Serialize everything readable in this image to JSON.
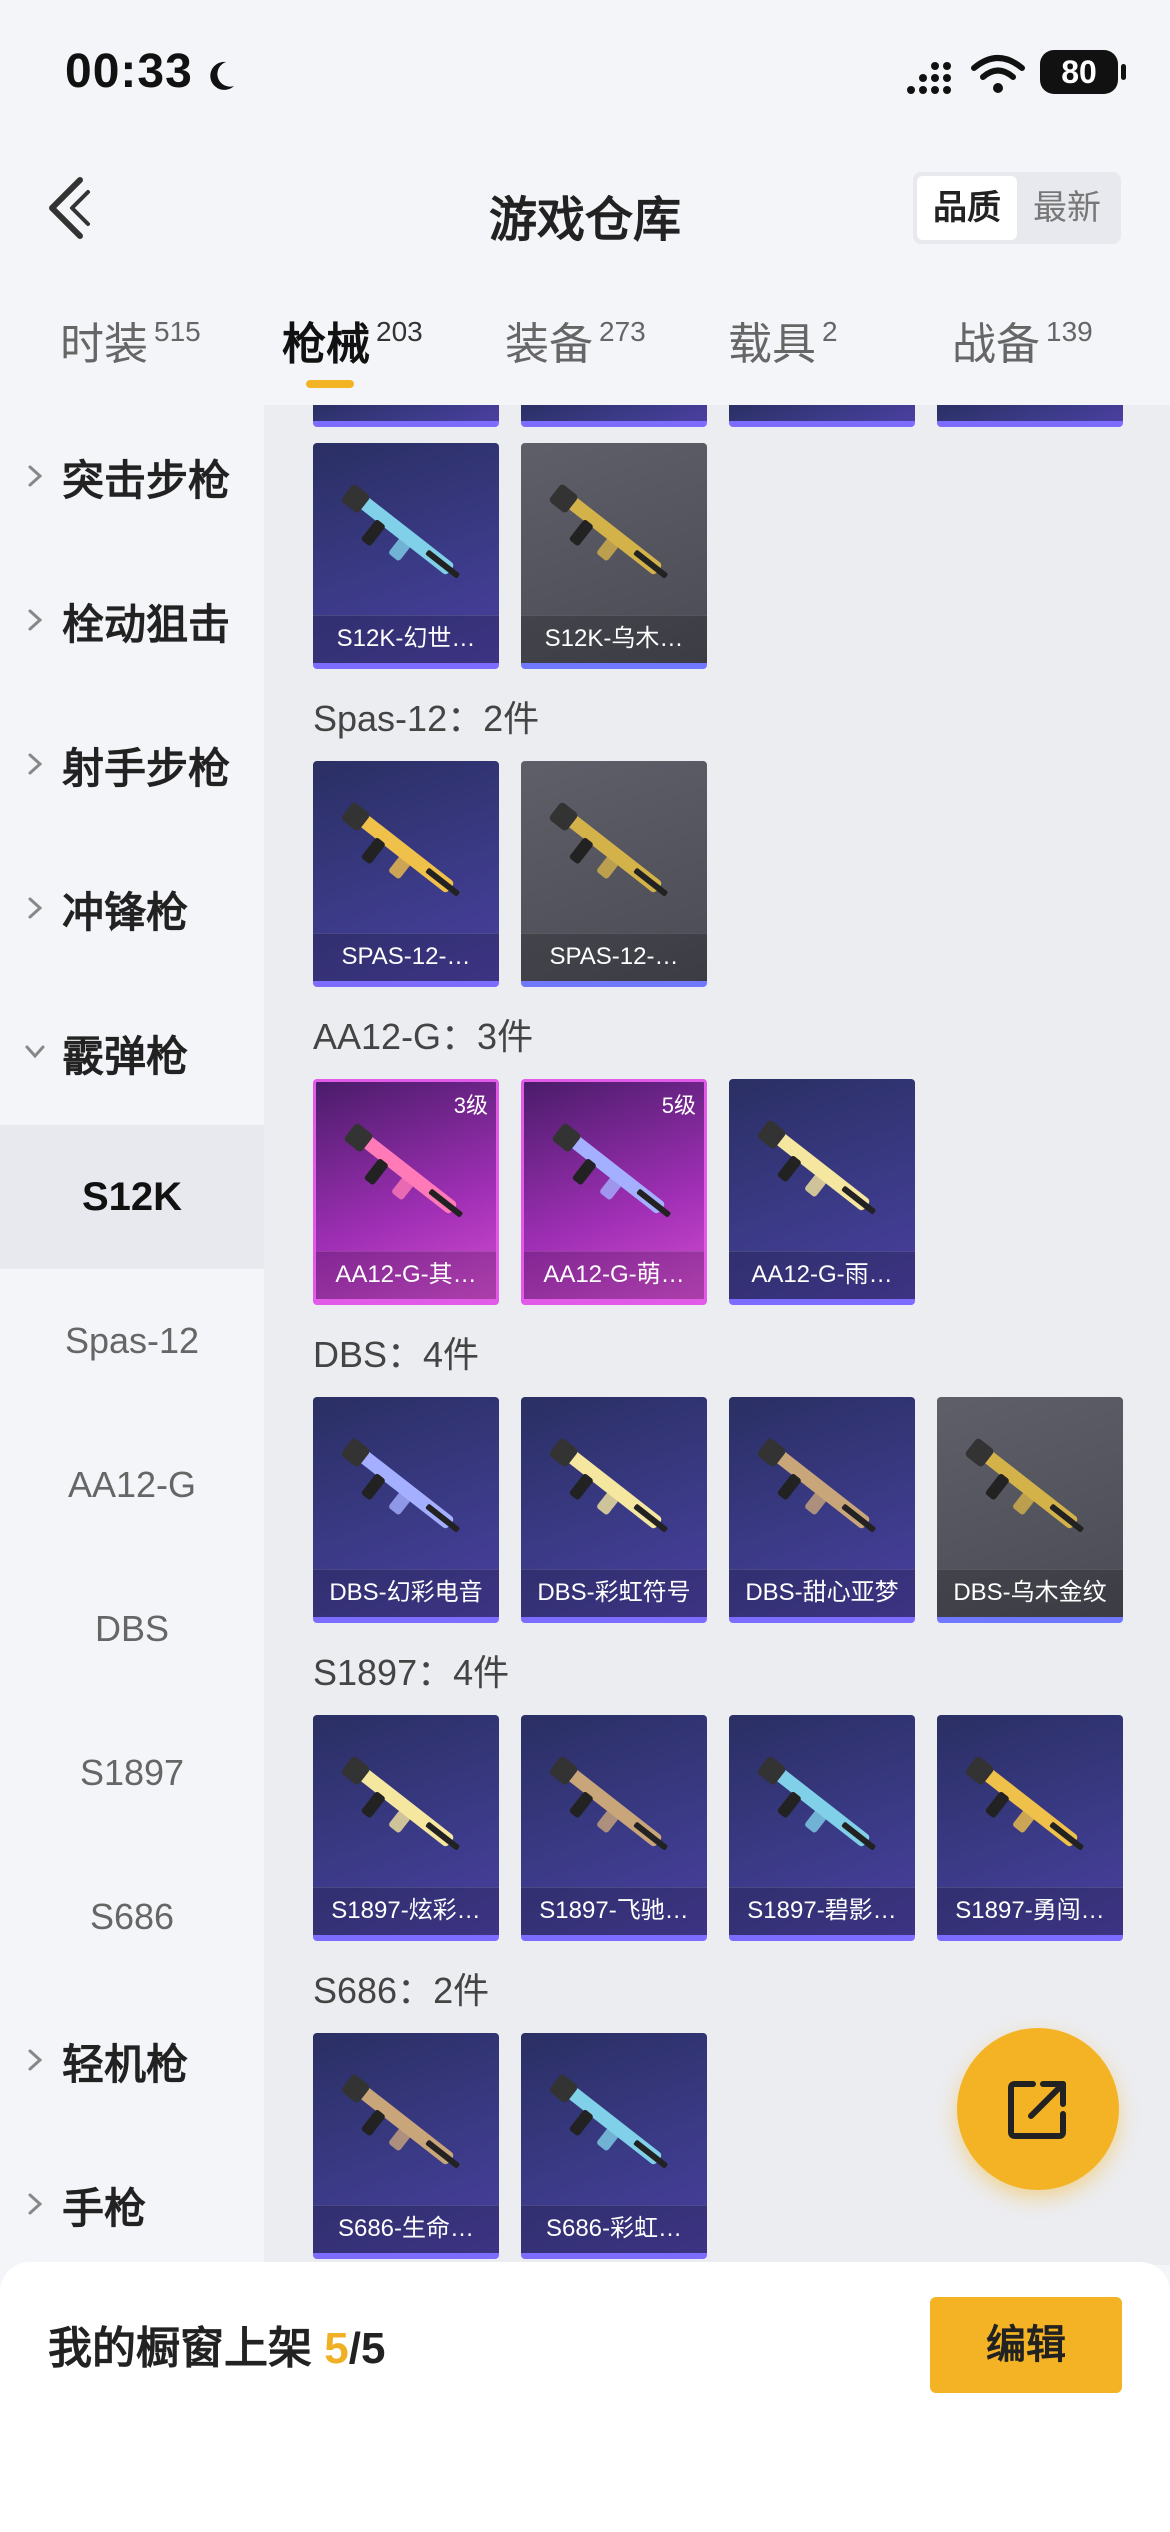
{
  "status_bar": {
    "time": "00:33",
    "battery": "80"
  },
  "header": {
    "title": "游戏仓库",
    "sort_options": [
      "品质",
      "最新"
    ],
    "sort_active": "品质"
  },
  "tabs": [
    {
      "label": "时装",
      "count": "515"
    },
    {
      "label": "枪械",
      "count": "203",
      "active": true
    },
    {
      "label": "装备",
      "count": "273"
    },
    {
      "label": "载具",
      "count": "2"
    },
    {
      "label": "战备",
      "count": "139"
    }
  ],
  "sidebar": {
    "categories": [
      "突击步枪",
      "栓动狙击",
      "射手步枪",
      "冲锋枪",
      "霰弹枪",
      "轻机枪",
      "手枪"
    ],
    "subitems": [
      "S12K",
      "Spas-12",
      "AA12-G",
      "DBS",
      "S1897",
      "S686"
    ],
    "active_subitem": "S12K"
  },
  "groups": [
    {
      "title": "",
      "items": [
        {
          "name": "S12K-幻世…",
          "style": "purple"
        },
        {
          "name": "S12K-乌木…",
          "style": "gray"
        }
      ]
    },
    {
      "title": "Spas-12：2件",
      "items": [
        {
          "name": "SPAS-12-…",
          "style": "purple"
        },
        {
          "name": "SPAS-12-…",
          "style": "gray"
        }
      ]
    },
    {
      "title": "AA12-G：3件",
      "items": [
        {
          "name": "AA12-G-其…",
          "style": "pink",
          "level": "3级"
        },
        {
          "name": "AA12-G-萌…",
          "style": "pink",
          "level": "5级"
        },
        {
          "name": "AA12-G-雨…",
          "style": "purple"
        }
      ]
    },
    {
      "title": "DBS：4件",
      "items": [
        {
          "name": "DBS-幻彩电音",
          "style": "purple"
        },
        {
          "name": "DBS-彩虹符号",
          "style": "purple"
        },
        {
          "name": "DBS-甜心亚梦",
          "style": "purple"
        },
        {
          "name": "DBS-乌木金纹",
          "style": "gray"
        }
      ]
    },
    {
      "title": "S1897：4件",
      "items": [
        {
          "name": "S1897-炫彩…",
          "style": "purple"
        },
        {
          "name": "S1897-飞驰…",
          "style": "purple"
        },
        {
          "name": "S1897-碧影…",
          "style": "purple"
        },
        {
          "name": "S1897-勇闯…",
          "style": "purple"
        }
      ]
    },
    {
      "title": "S686：2件",
      "items": [
        {
          "name": "S686-生命…",
          "style": "purple"
        },
        {
          "name": "S686-彩虹…",
          "style": "purple"
        }
      ]
    }
  ],
  "bottom_bar": {
    "label": "我的橱窗上架 ",
    "current": "5",
    "total": "/5",
    "edit_label": "编辑"
  },
  "colors": {
    "accent": "#f3b324",
    "card_purple": "#3a3a86",
    "card_gray": "#4a4b54",
    "card_pink": "#a02fb5"
  },
  "icons": [
    "moon-icon",
    "signal-icon",
    "wifi-icon",
    "battery-icon",
    "back-arrow-icon",
    "chevron-right-icon",
    "chevron-down-icon",
    "gun-icon",
    "share-icon"
  ]
}
